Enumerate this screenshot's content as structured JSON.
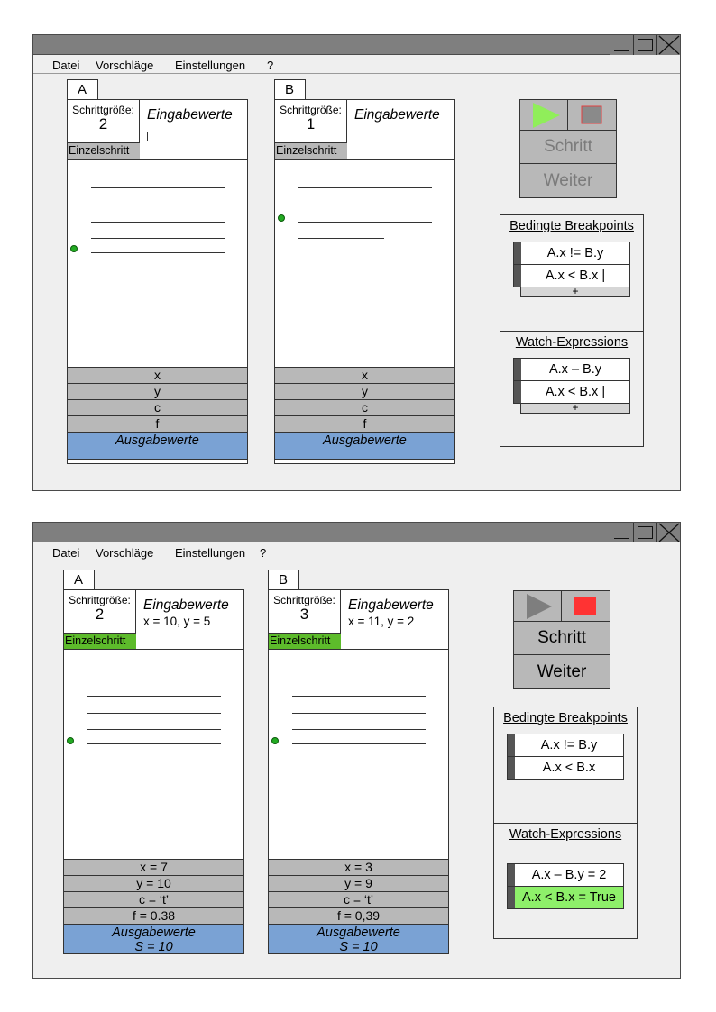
{
  "colors": {
    "titlebar": "#7f7f7f",
    "window_bg": "#efefef",
    "grey_row": "#b8b8b8",
    "output_blue": "#7aa2d4",
    "active_green": "#5dbb2b",
    "true_green": "#8ef06a",
    "breakpoint_dot": "#22aa22",
    "play_enabled": "#90ee5a",
    "stop_enabled": "#ff3333"
  },
  "icons": [
    "minimize-icon",
    "maximize-icon",
    "close-icon",
    "play-icon",
    "stop-icon",
    "breakpoint-icon"
  ],
  "windows": [
    {
      "menu": {
        "file": "Datei",
        "suggestions": "Vorschläge",
        "settings": "Einstellungen",
        "help": "?"
      },
      "panels": [
        {
          "tag": "A",
          "step_label": "Schrittgröße:",
          "step_value": "2",
          "single_step": "Einzelschritt",
          "single_step_active": false,
          "input_title": "Eingabewerte",
          "input_value": "",
          "vars": [
            "x",
            "y",
            "c",
            "f"
          ],
          "output_title": "Ausgabewerte",
          "output_value": ""
        },
        {
          "tag": "B",
          "step_label": "Schrittgröße:",
          "step_value": "1",
          "single_step": "Einzelschritt",
          "single_step_active": false,
          "input_title": "Eingabewerte",
          "input_value": "",
          "vars": [
            "x",
            "y",
            "c",
            "f"
          ],
          "output_title": "Ausgabewerte",
          "output_value": ""
        }
      ],
      "controls": {
        "step": "Schritt",
        "continue": "Weiter",
        "enabled": false
      },
      "breakpoints": {
        "title": "Bedingte Breakpoints",
        "items": [
          "A.x != B.y",
          "A.x < B.x |"
        ],
        "add": "+"
      },
      "watches": {
        "title": "Watch-Expressions",
        "items": [
          "A.x – B.y",
          "A.x < B.x |"
        ],
        "add": "+"
      }
    },
    {
      "menu": {
        "file": "Datei",
        "suggestions": "Vorschläge",
        "settings": "Einstellungen",
        "help": "?"
      },
      "panels": [
        {
          "tag": "A",
          "step_label": "Schrittgröße:",
          "step_value": "2",
          "single_step": "Einzelschritt",
          "single_step_active": true,
          "input_title": "Eingabewerte",
          "input_value": "x = 10, y = 5",
          "vars": [
            "x = 7",
            "y = 10",
            "c = ‘t’",
            "f = 0.38"
          ],
          "output_title": "Ausgabewerte",
          "output_value": "S = 10"
        },
        {
          "tag": "B",
          "step_label": "Schrittgröße:",
          "step_value": "3",
          "single_step": "Einzelschritt",
          "single_step_active": true,
          "input_title": "Eingabewerte",
          "input_value": "x = 11, y = 2",
          "vars": [
            "x = 3",
            "y = 9",
            "c = ‘t’",
            "f = 0,39"
          ],
          "output_title": "Ausgabewerte",
          "output_value": "S = 10"
        }
      ],
      "controls": {
        "step": "Schritt",
        "continue": "Weiter",
        "enabled": true
      },
      "breakpoints": {
        "title": "Bedingte Breakpoints",
        "items": [
          "A.x != B.y",
          "A.x < B.x"
        ],
        "add": ""
      },
      "watches": {
        "title": "Watch-Expressions",
        "items": [
          "A.x – B.y = 2",
          "A.x < B.x = True"
        ],
        "add": ""
      }
    }
  ]
}
